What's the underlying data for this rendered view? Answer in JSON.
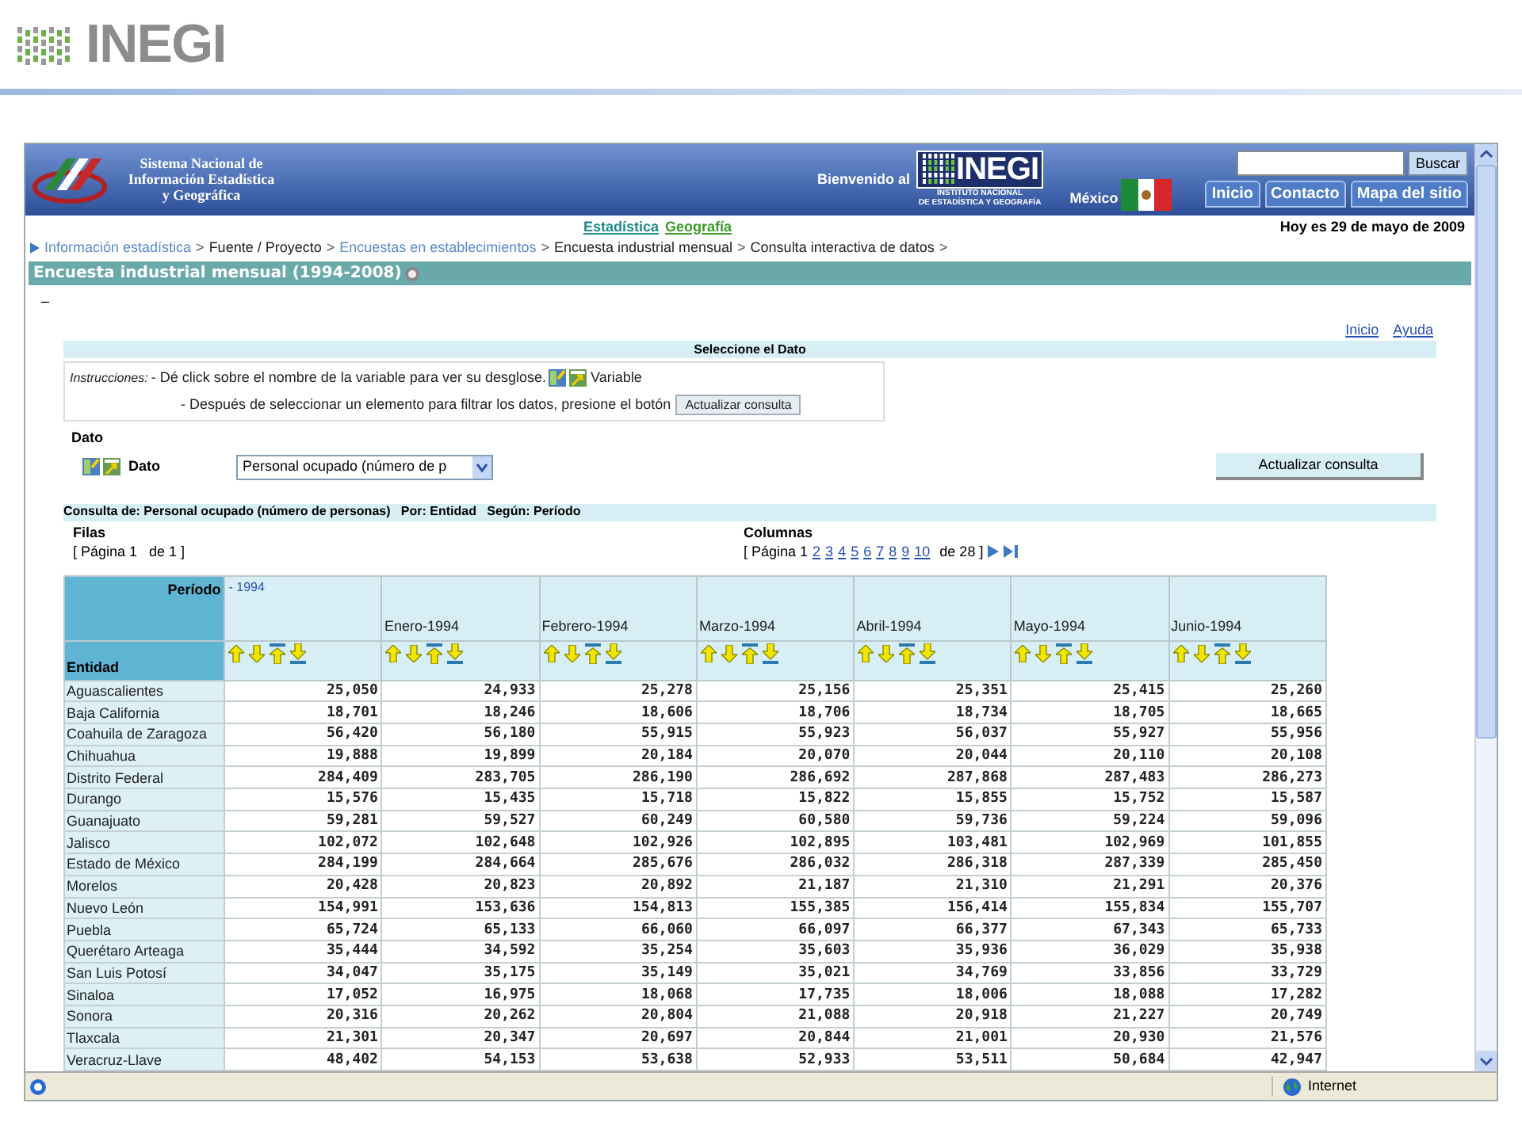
{
  "slide": {
    "logo_text": "INEGI"
  },
  "header": {
    "system_lines": [
      "Sistema Nacional de",
      "Información Estadística",
      "y Geográfica"
    ],
    "welcome": "Bienvenido al",
    "logo_text": "INEGI",
    "institute_lines": [
      "INSTITUTO NACIONAL",
      "DE ESTADÍSTICA Y GEOGRAFÍA"
    ],
    "country": "México",
    "search_button": "Buscar",
    "tabs": [
      "Inicio",
      "Contacto",
      "Mapa del sitio"
    ]
  },
  "sections": [
    {
      "label": "Estadística",
      "color": "#1f8a8a"
    },
    {
      "label": "Geografía",
      "color": "#3a9a2a"
    }
  ],
  "date": "Hoy es 29 de mayo de 2009",
  "breadcrumb": {
    "separator": ">",
    "items": [
      {
        "text": "Información estadística",
        "kind": "link"
      },
      {
        "text": "Fuente / Proyecto",
        "kind": "text"
      },
      {
        "text": "Encuestas en establecimientos",
        "kind": "link"
      },
      {
        "text": "Encuesta industrial mensual",
        "kind": "text"
      },
      {
        "text": "Consulta interactiva de datos",
        "kind": "text"
      }
    ]
  },
  "page_title": "Encuesta industrial mensual (1994-2008)",
  "collapse_mark": "–",
  "top_links": [
    "Inicio",
    "Ayuda"
  ],
  "select_panel": {
    "title": "Seleccione el Dato",
    "instructions_label": "Instrucciones:",
    "line_1": "- Dé click sobre el nombre de la variable para ver su desglose.",
    "variable_label": "Variable",
    "line_2": "- Después de seleccionar un elemento para filtrar los datos, presione el botón",
    "button": "Actualizar consulta"
  },
  "dato": {
    "heading": "Dato",
    "label": "Dato",
    "value": "Personal ocupado (número de p",
    "button": "Actualizar consulta"
  },
  "query_summary": "Consulta de: Personal ocupado (número de personas)   Por: Entidad   Según: Período",
  "rows_pager": {
    "title": "Filas",
    "text": "[ Página 1   de 1 ]"
  },
  "columns_pager": {
    "title": "Columnas",
    "prefix": "[ Página 1",
    "pages": [
      "2",
      "3",
      "4",
      "5",
      "6",
      "7",
      "8",
      "9",
      "10"
    ],
    "suffix": "de 28 ]"
  },
  "table": {
    "corner_top": "Período",
    "corner_bottom": "Entidad",
    "group": "- 1994",
    "columns": [
      "Enero-1994",
      "Febrero-1994",
      "Marzo-1994",
      "Abril-1994",
      "Mayo-1994",
      "Junio-1994"
    ],
    "rows": [
      {
        "entity": "Aguascalientes",
        "values": [
          "25,050",
          "24,933",
          "25,278",
          "25,156",
          "25,351",
          "25,415",
          "25,260"
        ]
      },
      {
        "entity": "Baja California",
        "values": [
          "18,701",
          "18,246",
          "18,606",
          "18,706",
          "18,734",
          "18,705",
          "18,665"
        ]
      },
      {
        "entity": "Coahuila de Zaragoza",
        "values": [
          "56,420",
          "56,180",
          "55,915",
          "55,923",
          "56,037",
          "55,927",
          "55,956"
        ]
      },
      {
        "entity": "Chihuahua",
        "values": [
          "19,888",
          "19,899",
          "20,184",
          "20,070",
          "20,044",
          "20,110",
          "20,108"
        ]
      },
      {
        "entity": "Distrito Federal",
        "values": [
          "284,409",
          "283,705",
          "286,190",
          "286,692",
          "287,868",
          "287,483",
          "286,273"
        ]
      },
      {
        "entity": "Durango",
        "values": [
          "15,576",
          "15,435",
          "15,718",
          "15,822",
          "15,855",
          "15,752",
          "15,587"
        ]
      },
      {
        "entity": "Guanajuato",
        "values": [
          "59,281",
          "59,527",
          "60,249",
          "60,580",
          "59,736",
          "59,224",
          "59,096"
        ]
      },
      {
        "entity": "Jalisco",
        "values": [
          "102,072",
          "102,648",
          "102,926",
          "102,895",
          "103,481",
          "102,969",
          "101,855"
        ]
      },
      {
        "entity": "Estado de México",
        "values": [
          "284,199",
          "284,664",
          "285,676",
          "286,032",
          "286,318",
          "287,339",
          "285,450"
        ]
      },
      {
        "entity": "Morelos",
        "values": [
          "20,428",
          "20,823",
          "20,892",
          "21,187",
          "21,310",
          "21,291",
          "20,376"
        ]
      },
      {
        "entity": "Nuevo León",
        "values": [
          "154,991",
          "153,636",
          "154,813",
          "155,385",
          "156,414",
          "155,834",
          "155,707"
        ]
      },
      {
        "entity": "Puebla",
        "values": [
          "65,724",
          "65,133",
          "66,060",
          "66,097",
          "66,377",
          "67,343",
          "65,733"
        ]
      },
      {
        "entity": "Querétaro Arteaga",
        "values": [
          "35,444",
          "34,592",
          "35,254",
          "35,603",
          "35,936",
          "36,029",
          "35,938"
        ]
      },
      {
        "entity": "San Luis Potosí",
        "values": [
          "34,047",
          "35,175",
          "35,149",
          "35,021",
          "34,769",
          "33,856",
          "33,729"
        ]
      },
      {
        "entity": "Sinaloa",
        "values": [
          "17,052",
          "16,975",
          "18,068",
          "17,735",
          "18,006",
          "18,088",
          "17,282"
        ]
      },
      {
        "entity": "Sonora",
        "values": [
          "20,316",
          "20,262",
          "20,804",
          "21,088",
          "20,918",
          "21,227",
          "20,749"
        ]
      },
      {
        "entity": "Tlaxcala",
        "values": [
          "21,301",
          "20,347",
          "20,697",
          "20,844",
          "21,001",
          "20,930",
          "21,576"
        ]
      },
      {
        "entity": "Veracruz-Llave",
        "values": [
          "48,402",
          "54,153",
          "53,638",
          "52,933",
          "53,511",
          "50,684",
          "42,947"
        ]
      }
    ]
  },
  "status_bar": {
    "zone": "Internet"
  }
}
